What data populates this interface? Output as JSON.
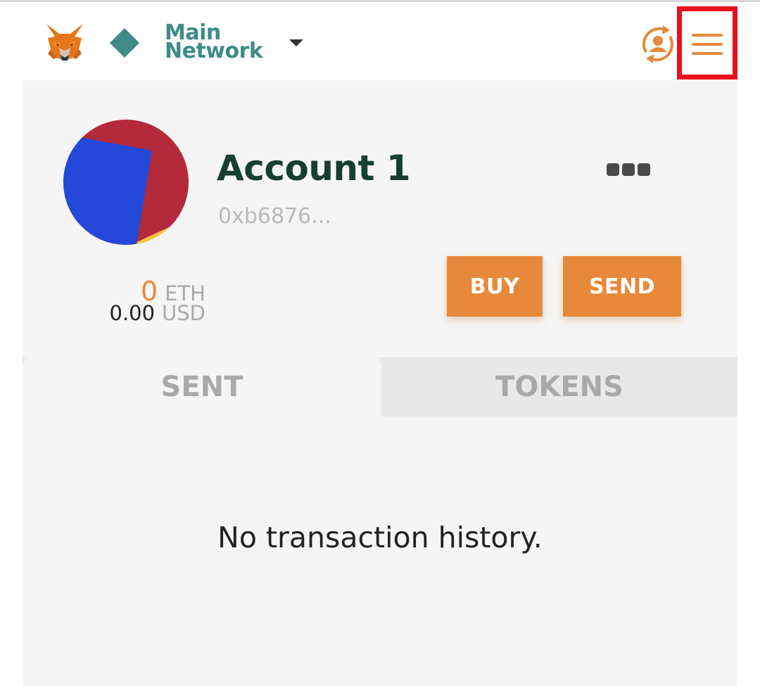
{
  "header": {
    "logo": "metamask-fox-icon",
    "network_icon": "diamond-icon",
    "network_line1": "Main",
    "network_line2": "Network",
    "network_dropdown_icon": "caret-down-icon",
    "account_switch_icon": "account-switch-icon",
    "menu_icon": "hamburger-menu-icon",
    "menu_highlight_color": "#e8101c"
  },
  "account": {
    "name": "Account 1",
    "address": "0xb6876...",
    "options_icon": "more-dots-icon"
  },
  "balance": {
    "eth_value": "0",
    "eth_unit": "ETH",
    "usd_value": "0.00",
    "usd_unit": "USD"
  },
  "actions": {
    "buy_label": "BUY",
    "send_label": "SEND"
  },
  "tabs": [
    {
      "label": "SENT",
      "active": true
    },
    {
      "label": "TOKENS",
      "active": false
    }
  ],
  "transactions": {
    "empty_message": "No transaction history."
  },
  "colors": {
    "accent_orange": "#e6893a",
    "network_teal": "#3e8b87",
    "account_name": "#163f2f"
  }
}
